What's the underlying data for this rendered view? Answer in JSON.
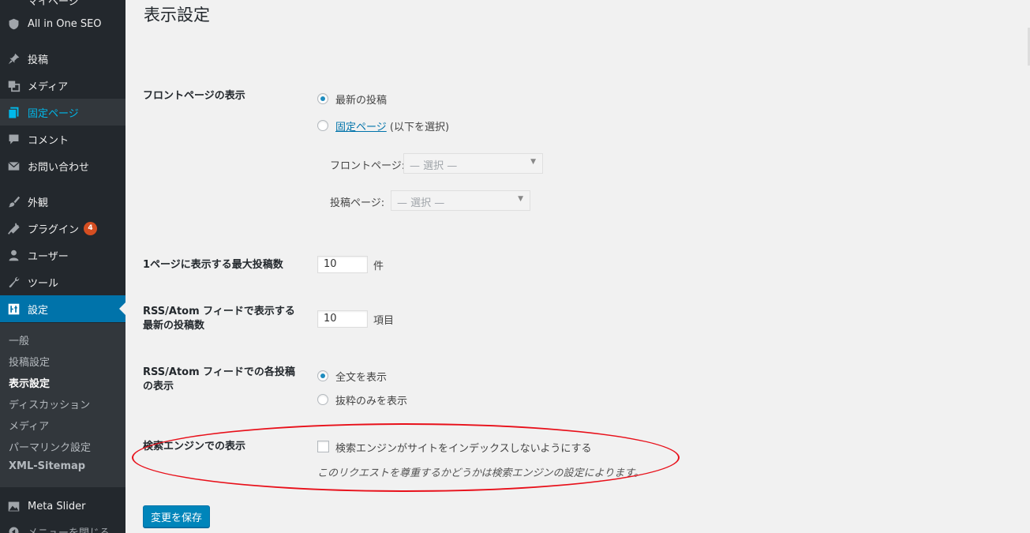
{
  "sidebar": {
    "top_partial": "マイページ",
    "items": [
      {
        "label": "All in One SEO",
        "icon": "shield-icon"
      },
      {
        "label": "投稿",
        "icon": "pin-icon"
      },
      {
        "label": "メディア",
        "icon": "media-icon"
      },
      {
        "label": "固定ページ",
        "icon": "pages-icon"
      },
      {
        "label": "コメント",
        "icon": "comment-icon"
      },
      {
        "label": "お問い合わせ",
        "icon": "mail-icon"
      },
      {
        "label": "外観",
        "icon": "brush-icon"
      },
      {
        "label": "プラグイン",
        "icon": "plugin-icon",
        "badge": "4"
      },
      {
        "label": "ユーザー",
        "icon": "user-icon"
      },
      {
        "label": "ツール",
        "icon": "wrench-icon"
      },
      {
        "label": "設定",
        "icon": "settings-icon"
      },
      {
        "label": "Meta Slider",
        "icon": "slider-icon"
      },
      {
        "label": "メニューを閉じる",
        "icon": "collapse-icon"
      }
    ],
    "submenu": [
      "一般",
      "投稿設定",
      "表示設定",
      "ディスカッション",
      "メディア",
      "パーマリンク設定",
      "XML-Sitemap"
    ]
  },
  "page": {
    "title": "表示設定",
    "front_page": {
      "label": "フロントページの表示",
      "option_latest": "最新の投稿",
      "option_static_link": "固定ページ",
      "option_static_suffix": " (以下を選択)",
      "front_select_label": "フロントページ:",
      "front_select_value": "— 選択 —",
      "posts_select_label": "投稿ページ:",
      "posts_select_value": "— 選択 —"
    },
    "posts_per_page": {
      "label": "1ページに表示する最大投稿数",
      "value": "10",
      "unit": "件"
    },
    "rss_posts": {
      "label": "RSS/Atom フィードで表示する最新の投稿数",
      "value": "10",
      "unit": "項目"
    },
    "rss_use_excerpt": {
      "label": "RSS/Atom フィードでの各投稿の表示",
      "option_full": "全文を表示",
      "option_summary": "抜粋のみを表示"
    },
    "search_visibility": {
      "label": "検索エンジンでの表示",
      "checkbox_label": "検索エンジンがサイトをインデックスしないようにする",
      "description": "このリクエストを尊重するかどうかは検索エンジンの設定によります。"
    },
    "save_button": "変更を保存"
  },
  "colors": {
    "sidebar_bg": "#23282d",
    "active_bg": "#0073aa",
    "accent": "#00b9eb",
    "badge": "#d54e21",
    "highlight_ellipse": "#e8101a",
    "button": "#0085ba"
  }
}
